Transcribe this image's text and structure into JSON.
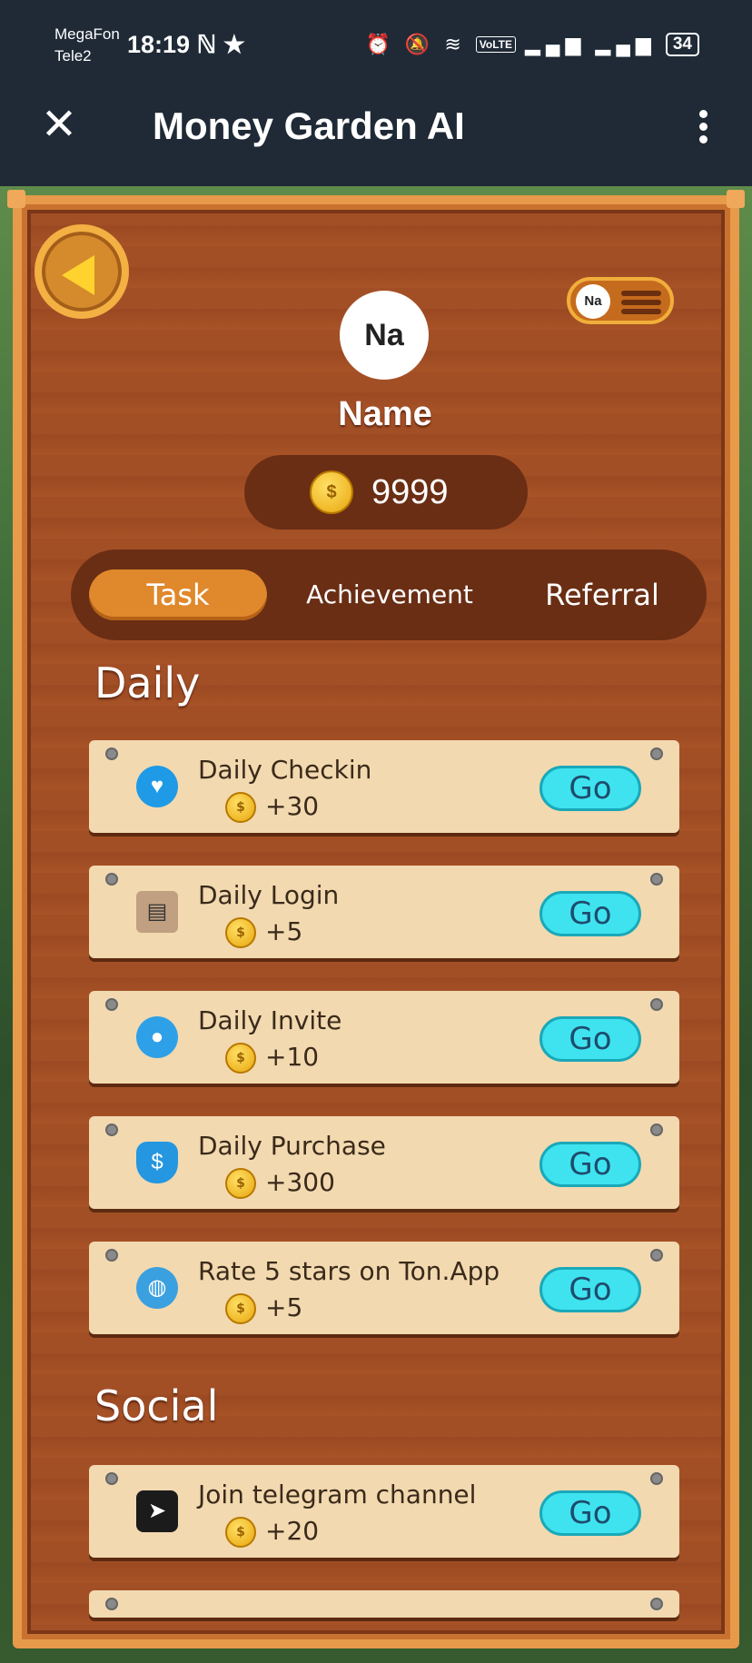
{
  "status_bar": {
    "carrier1": "MegaFon",
    "carrier2": "Tele2",
    "time": "18:19",
    "extra_icons": "ℕ ★",
    "volte": "VoLTE",
    "battery": "34"
  },
  "app_bar": {
    "title": "Money Garden AI"
  },
  "profile": {
    "initials": "Na",
    "name": "Name",
    "coins": "9999"
  },
  "tabs": {
    "task": "Task",
    "achievement": "Achievement",
    "referral": "Referral"
  },
  "sections": {
    "daily": "Daily",
    "social": "Social"
  },
  "daily_tasks": [
    {
      "name": "Daily Checkin",
      "reward": "+30",
      "icon": "heart-pin-icon",
      "go": "Go"
    },
    {
      "name": "Daily Login",
      "reward": "+5",
      "icon": "clipboard-icon",
      "go": "Go"
    },
    {
      "name": "Daily Invite",
      "reward": "+10",
      "icon": "person-icon",
      "go": "Go"
    },
    {
      "name": "Daily Purchase",
      "reward": "+300",
      "icon": "money-bag-icon",
      "go": "Go"
    },
    {
      "name": "Rate 5 stars on Ton.App",
      "reward": "+5",
      "icon": "earth-icon",
      "go": "Go"
    }
  ],
  "social_tasks": [
    {
      "name": "Join telegram channel",
      "reward": "+20",
      "icon": "telegram-icon",
      "go": "Go"
    }
  ],
  "colors": {
    "board": "#a34f26",
    "frame": "#e79a4a",
    "card": "#f2d9b0",
    "go_button": "#3fe3f0",
    "active_tab": "#e0882c"
  }
}
